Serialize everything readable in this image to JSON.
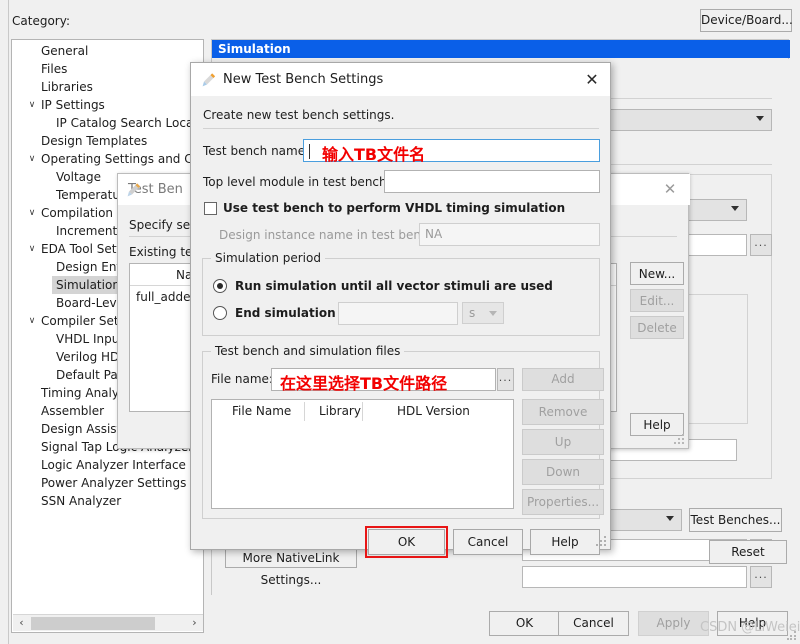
{
  "window": {
    "category_label": "Category:",
    "device_board_button": "Device/Board...",
    "watermark": "CSDN @LiWeiei"
  },
  "tree": {
    "items": [
      {
        "label": "General",
        "depth": 0,
        "arrow": "",
        "selected": false
      },
      {
        "label": "Files",
        "depth": 0,
        "arrow": "",
        "selected": false
      },
      {
        "label": "Libraries",
        "depth": 0,
        "arrow": "",
        "selected": false
      },
      {
        "label": "IP Settings",
        "depth": 0,
        "arrow": "v",
        "selected": false
      },
      {
        "label": "IP Catalog Search Location",
        "depth": 1,
        "arrow": "",
        "selected": false
      },
      {
        "label": "Design Templates",
        "depth": 0,
        "arrow": "",
        "selected": false
      },
      {
        "label": "Operating Settings and Conditions",
        "depth": 0,
        "arrow": "v",
        "selected": false
      },
      {
        "label": "Voltage",
        "depth": 1,
        "arrow": "",
        "selected": false
      },
      {
        "label": "Temperature",
        "depth": 1,
        "arrow": "",
        "selected": false
      },
      {
        "label": "Compilation Process Settings",
        "depth": 0,
        "arrow": "v",
        "selected": false
      },
      {
        "label": "Incremental Compilation",
        "depth": 1,
        "arrow": "",
        "selected": false
      },
      {
        "label": "EDA Tool Settings",
        "depth": 0,
        "arrow": "v",
        "selected": false
      },
      {
        "label": "Design Entry/Synthesis",
        "depth": 1,
        "arrow": "",
        "selected": false
      },
      {
        "label": "Simulation",
        "depth": 1,
        "arrow": "",
        "selected": true
      },
      {
        "label": "Board-Level",
        "depth": 1,
        "arrow": "",
        "selected": false
      },
      {
        "label": "Compiler Settings",
        "depth": 0,
        "arrow": "v",
        "selected": false
      },
      {
        "label": "VHDL Input",
        "depth": 1,
        "arrow": "",
        "selected": false
      },
      {
        "label": "Verilog HDL Input",
        "depth": 1,
        "arrow": "",
        "selected": false
      },
      {
        "label": "Default Parameters",
        "depth": 1,
        "arrow": "",
        "selected": false
      },
      {
        "label": "Timing Analyzer",
        "depth": 0,
        "arrow": "",
        "selected": false
      },
      {
        "label": "Assembler",
        "depth": 0,
        "arrow": "",
        "selected": false
      },
      {
        "label": "Design Assistant",
        "depth": 0,
        "arrow": "",
        "selected": false
      },
      {
        "label": "Signal Tap Logic Analyzer",
        "depth": 0,
        "arrow": "",
        "selected": false
      },
      {
        "label": "Logic Analyzer Interface",
        "depth": 0,
        "arrow": "",
        "selected": false
      },
      {
        "label": "Power Analyzer Settings",
        "depth": 0,
        "arrow": "",
        "selected": false
      },
      {
        "label": "SSN Analyzer",
        "depth": 0,
        "arrow": "",
        "selected": false
      }
    ],
    "scroll_left_arrow": "‹",
    "scroll_right_arrow": "›"
  },
  "simulation_panel": {
    "title": "Simulation",
    "more_nativelink_button": "More NativeLink Settings...",
    "test_benches_button": "Test Benches...",
    "reset_button": "Reset",
    "ellipsis_button": "..."
  },
  "test_benches_dialog": {
    "title": "Test Ben",
    "close_icon": "✕",
    "subtitle": "Specify setti",
    "existing_label": "Existing test",
    "table": {
      "columns": [
        "Name"
      ],
      "rows": [
        [
          "full_adder_"
        ]
      ]
    },
    "buttons": {
      "new": "New...",
      "edit": "Edit...",
      "delete": "Delete",
      "help": "Help"
    }
  },
  "new_test_bench_dialog": {
    "title": "New Test Bench Settings",
    "close_icon": "✕",
    "subtitle": "Create new test bench settings.",
    "test_bench_name_label": "Test bench name:",
    "test_bench_name_value": "",
    "test_bench_name_annotation": "输入TB文件名",
    "top_level_module_label": "Top level module in test bench:",
    "top_level_module_value": "",
    "vhdl_timing_checkbox_label": "Use test bench to perform VHDL timing simulation",
    "vhdl_timing_checked": false,
    "design_instance_label": "Design instance name in test bench:",
    "design_instance_value": "NA",
    "simulation_period": {
      "legend": "Simulation period",
      "option_run_all": "Run simulation until all vector stimuli are used",
      "option_end_at": "End simulation at:",
      "selected": "run_all",
      "end_at_value": "",
      "unit_value": "s"
    },
    "files_group": {
      "legend": "Test bench and simulation files",
      "file_name_label": "File name:",
      "file_name_value": "",
      "file_name_annotation": "在这里选择TB文件路径",
      "browse_button": "...",
      "columns": [
        "File Name",
        "Library",
        "HDL Version"
      ],
      "rows": [],
      "buttons": {
        "add": "Add",
        "remove": "Remove",
        "up": "Up",
        "down": "Down",
        "properties": "Properties..."
      }
    },
    "footer": {
      "ok": "OK",
      "cancel": "Cancel",
      "help": "Help"
    }
  },
  "main_footer": {
    "ok": "OK",
    "cancel": "Cancel",
    "apply": "Apply",
    "help": "Help"
  },
  "colors": {
    "panel_title_blue": "#0a5fe8",
    "annotation_red": "#f20000",
    "highlight_border_red": "#e81515",
    "focus_blue": "#4a9ede",
    "window_bg": "#f0f0f0"
  }
}
